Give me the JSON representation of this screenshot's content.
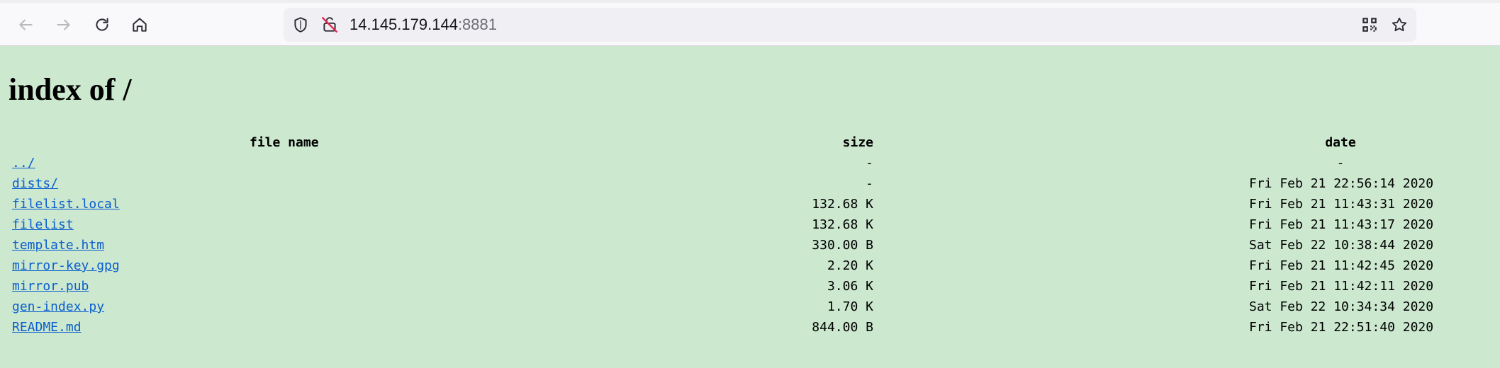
{
  "browser": {
    "back_icon": "arrow-left-icon",
    "forward_icon": "arrow-right-icon",
    "reload_icon": "reload-icon",
    "home_icon": "home-icon",
    "url_host": "14.145.179.144",
    "url_port": ":8881",
    "shield_icon": "shield-icon",
    "insecure_icon": "insecure-lock-icon",
    "qr_icon": "qr-code-icon",
    "bookmark_icon": "star-icon"
  },
  "page": {
    "title": "index of /",
    "headers": {
      "name": "file name",
      "size": "size",
      "date": "date"
    },
    "rows": [
      {
        "name": "../",
        "size": "-",
        "date": "-"
      },
      {
        "name": "dists/",
        "size": "-",
        "date": "Fri Feb 21 22:56:14 2020"
      },
      {
        "name": "filelist.local",
        "size": "132.68 K",
        "date": "Fri Feb 21 11:43:31 2020"
      },
      {
        "name": "filelist",
        "size": "132.68 K",
        "date": "Fri Feb 21 11:43:17 2020"
      },
      {
        "name": "template.htm",
        "size": "330.00 B",
        "date": "Sat Feb 22 10:38:44 2020"
      },
      {
        "name": "mirror-key.gpg",
        "size": "2.20 K",
        "date": "Fri Feb 21 11:42:45 2020"
      },
      {
        "name": "mirror.pub",
        "size": "3.06 K",
        "date": "Fri Feb 21 11:42:11 2020"
      },
      {
        "name": "gen-index.py",
        "size": "1.70 K",
        "date": "Sat Feb 22 10:34:34 2020"
      },
      {
        "name": "README.md",
        "size": "844.00 B",
        "date": "Fri Feb 21 22:51:40 2020"
      }
    ]
  },
  "colors": {
    "page_background": "#cce8cf",
    "link": "#0b5ecf",
    "toolbar_background": "#f9f9fb",
    "urlbar_background": "#f0f0f4"
  }
}
